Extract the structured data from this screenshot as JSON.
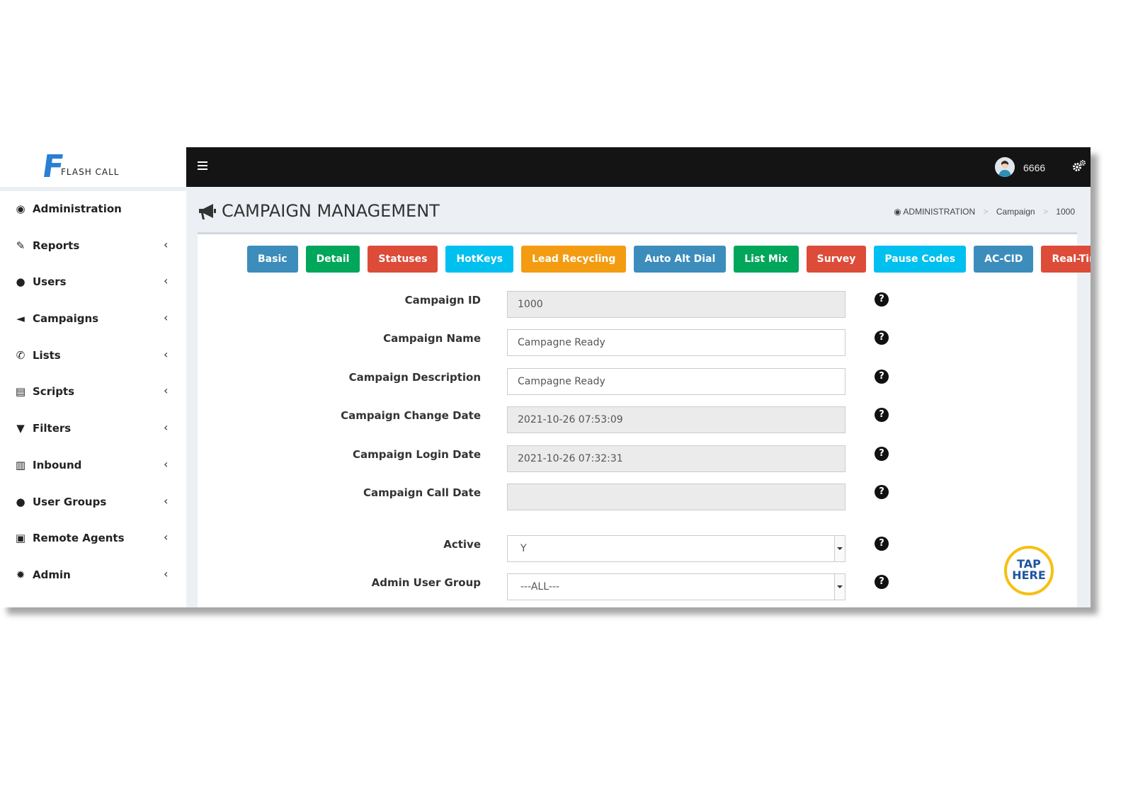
{
  "logo": {
    "letter": "F",
    "text": "FLASH CALL"
  },
  "sidebar": {
    "items": [
      {
        "label": "Administration",
        "icon": "dashboard-icon",
        "glyph": "◉",
        "chevron": false
      },
      {
        "label": "Reports",
        "icon": "edit-icon",
        "glyph": "✎",
        "chevron": true
      },
      {
        "label": "Users",
        "icon": "user-icon",
        "glyph": "●",
        "chevron": true
      },
      {
        "label": "Campaigns",
        "icon": "bullhorn-icon",
        "glyph": "◄",
        "chevron": true
      },
      {
        "label": "Lists",
        "icon": "phone-icon",
        "glyph": "✆",
        "chevron": true
      },
      {
        "label": "Scripts",
        "icon": "document-icon",
        "glyph": "▤",
        "chevron": true
      },
      {
        "label": "Filters",
        "icon": "filter-icon",
        "glyph": "▼",
        "chevron": true
      },
      {
        "label": "Inbound",
        "icon": "bar-chart-icon",
        "glyph": "▥",
        "chevron": true
      },
      {
        "label": "User Groups",
        "icon": "users-icon",
        "glyph": "●",
        "chevron": true
      },
      {
        "label": "Remote Agents",
        "icon": "lock-icon",
        "glyph": "▣",
        "chevron": true
      },
      {
        "label": "Admin",
        "icon": "gear-icon",
        "glyph": "✹",
        "chevron": true
      }
    ],
    "chevron_glyph": "‹"
  },
  "topbar": {
    "username": "6666"
  },
  "header": {
    "title": "CAMPAIGN MANAGEMENT",
    "breadcrumb": {
      "root": "ADMINISTRATION",
      "section": "Campaign",
      "current": "1000",
      "sep": ">"
    }
  },
  "tabs": [
    {
      "label": "Basic",
      "color": "#3c8dbc"
    },
    {
      "label": "Detail",
      "color": "#00a65a"
    },
    {
      "label": "Statuses",
      "color": "#dd4b39"
    },
    {
      "label": "HotKeys",
      "color": "#00c0ef"
    },
    {
      "label": "Lead Recycling",
      "color": "#f39c12"
    },
    {
      "label": "Auto Alt Dial",
      "color": "#3c8dbc"
    },
    {
      "label": "List Mix",
      "color": "#00a65a"
    },
    {
      "label": "Survey",
      "color": "#dd4b39"
    },
    {
      "label": "Pause Codes",
      "color": "#00c0ef"
    },
    {
      "label": "AC-CID",
      "color": "#3c8dbc"
    },
    {
      "label": "Real-Time",
      "color": "#dd4b39"
    }
  ],
  "form": {
    "campaign_id": {
      "label": "Campaign ID",
      "value": "1000"
    },
    "campaign_name": {
      "label": "Campaign Name",
      "value": "Campagne Ready"
    },
    "campaign_description": {
      "label": "Campaign Description",
      "value": "Campagne Ready"
    },
    "campaign_change_date": {
      "label": "Campaign Change Date",
      "value": "2021-10-26 07:53:09"
    },
    "campaign_login_date": {
      "label": "Campaign Login Date",
      "value": "2021-10-26 07:32:31"
    },
    "campaign_call_date": {
      "label": "Campaign Call Date",
      "value": ""
    },
    "active": {
      "label": "Active",
      "value": "Y"
    },
    "admin_user_group": {
      "label": "Admin User Group",
      "value": "---ALL---"
    }
  },
  "help_glyph": "?",
  "tap_badge": {
    "line1": "TAP",
    "line2": "HERE"
  }
}
